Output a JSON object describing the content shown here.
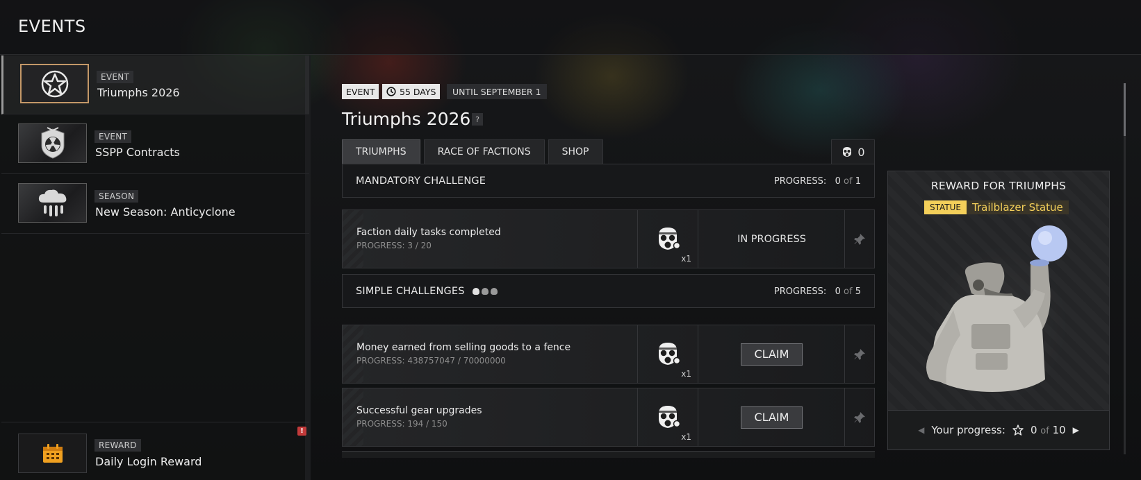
{
  "header": {
    "title": "EVENTS"
  },
  "sidebar": {
    "items": [
      {
        "tag": "EVENT",
        "title": "Triumphs 2026",
        "icon": "star-icon"
      },
      {
        "tag": "EVENT",
        "title": "SSPP Contracts",
        "icon": "radiation-emblem-icon"
      },
      {
        "tag": "SEASON",
        "title": "New Season: Anticyclone",
        "icon": "storm-cloud-icon"
      }
    ],
    "reward": {
      "tag": "REWARD",
      "title": "Daily Login Reward",
      "icon": "calendar-icon",
      "badge": "!"
    }
  },
  "main": {
    "chips": {
      "event": "EVENT",
      "days": "55 DAYS",
      "until": "UNTIL SEPTEMBER 1"
    },
    "title": "Triumphs 2026",
    "help": "?",
    "tabs": [
      "TRIUMPHS",
      "RACE OF FACTIONS",
      "SHOP"
    ],
    "currency": {
      "value": "0",
      "icon": "gas-mask-icon"
    },
    "mandatory": {
      "label": "MANDATORY CHALLENGE",
      "progress_label": "PROGRESS:",
      "done": "0",
      "of": "of",
      "total": "1",
      "tasks": [
        {
          "title": "Faction daily tasks completed",
          "progress": "PROGRESS: 3 / 20",
          "qty": "x1",
          "status": "IN PROGRESS"
        }
      ]
    },
    "simple": {
      "label": "SIMPLE CHALLENGES",
      "progress_label": "PROGRESS:",
      "done": "0",
      "of": "of",
      "total": "5",
      "tasks": [
        {
          "title": "Money earned from selling goods to a fence",
          "progress": "PROGRESS: 438757047 / 70000000",
          "qty": "x1",
          "status": "CLAIM"
        },
        {
          "title": "Successful gear upgrades",
          "progress": "PROGRESS: 194 / 150",
          "qty": "x1",
          "status": "CLAIM"
        }
      ]
    }
  },
  "reward_panel": {
    "title": "REWARD FOR  TRIUMPHS",
    "tag": "STATUE",
    "name": "Trailblazer Statue",
    "progress_label": "Your progress:",
    "done": "0",
    "of": "of",
    "total": "10"
  },
  "colors": {
    "accent_gold": "#f3cf5a",
    "active_border": "#c49868",
    "alert": "#c23a3a"
  }
}
